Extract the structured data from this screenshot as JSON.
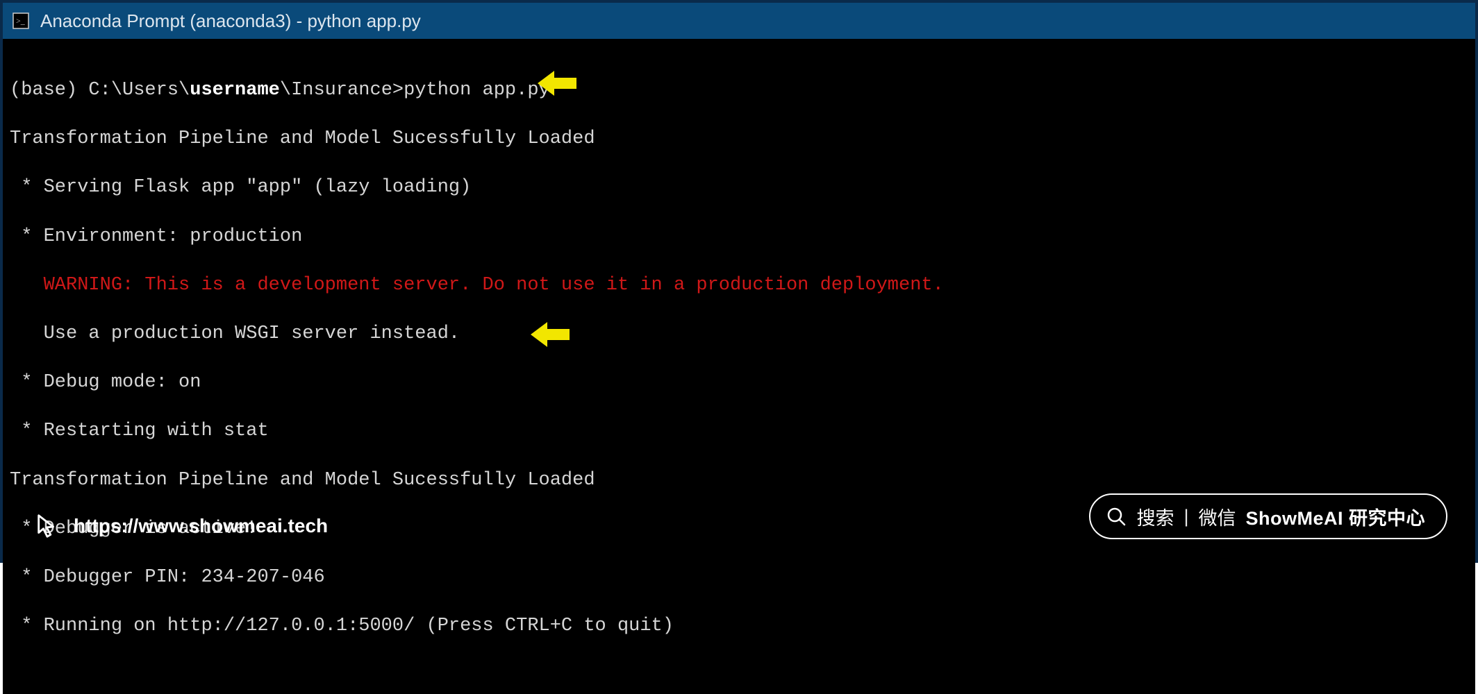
{
  "window": {
    "title": "Anaconda Prompt (anaconda3) - python  app.py"
  },
  "terminal": {
    "prompt_prefix": "(base) C:\\Users\\",
    "username": "username",
    "prompt_suffix": "\\Insurance>python app.py",
    "lines": {
      "l1": "Transformation Pipeline and Model Sucessfully Loaded",
      "l2": " * Serving Flask app \"app\" (lazy loading)",
      "l3": " * Environment: production",
      "l4_indent": "   ",
      "l4_warn": "WARNING: This is a development server. Do not use it in a production deployment.",
      "l5": "   Use a production WSGI server instead.",
      "l6": " * Debug mode: on",
      "l7": " * Restarting with stat",
      "l8": "Transformation Pipeline and Model Sucessfully Loaded",
      "l9": " * Debugger is active!",
      "l10": " * Debugger PIN: 234-207-046",
      "l11": " * Running on http://127.0.0.1:5000/ (Press CTRL+C to quit)"
    }
  },
  "footer": {
    "url": "https://www.showmeai.tech"
  },
  "search_pill": {
    "search_label": "搜索",
    "separator": "|",
    "wechat_label": "微信",
    "brand": "ShowMeAI 研究中心"
  },
  "colors": {
    "title_bar_bg": "#0a4a7a",
    "terminal_bg": "#000000",
    "terminal_fg": "#d6d6d6",
    "warning_fg": "#d01818",
    "arrow_fill": "#f2e600"
  }
}
